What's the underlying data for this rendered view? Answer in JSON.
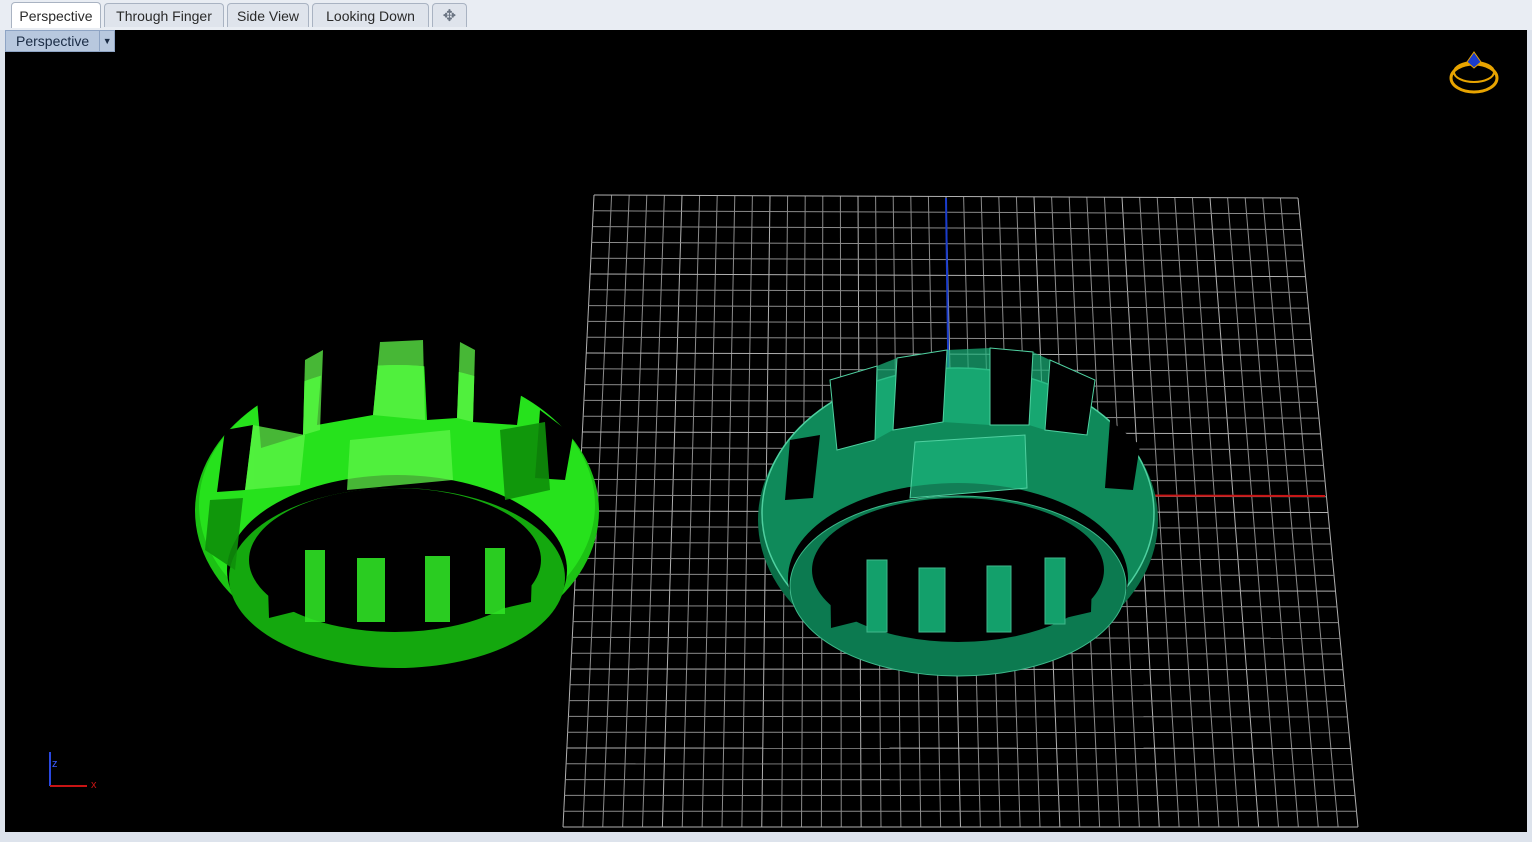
{
  "tabs": [
    {
      "label": "Perspective",
      "active": true
    },
    {
      "label": "Through Finger",
      "active": false
    },
    {
      "label": "Side View",
      "active": false
    },
    {
      "label": "Looking Down",
      "active": false
    }
  ],
  "add_tab_icon": "plus-icon",
  "viewport": {
    "name": "Perspective",
    "menu_icon": "chevron-down-icon",
    "background": "#000000",
    "grid_color": "#8a8a8a",
    "axis_x_color": "#c81414",
    "axis_y_color": "#1a3ccc",
    "ring_left_color": "#22e01a",
    "ring_right_color": "#0f8a5a",
    "ring_icon_color": "#e8a400",
    "axis_labels": {
      "z": "z",
      "x": "x"
    }
  }
}
